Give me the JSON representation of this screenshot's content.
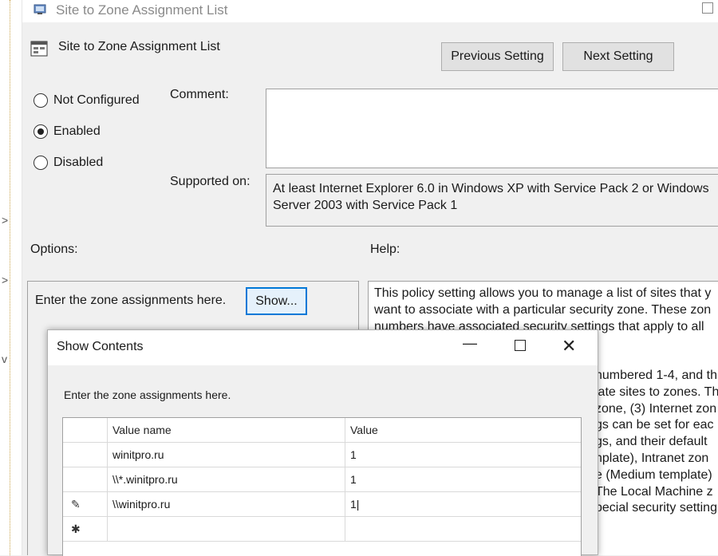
{
  "parent_tree": {
    "chevrons": [
      ">",
      ">",
      "v"
    ]
  },
  "window": {
    "title": "Site to Zone Assignment List"
  },
  "setting": {
    "name": "Site to Zone Assignment List",
    "previous_button": "Previous Setting",
    "next_button": "Next Setting"
  },
  "state": {
    "options": [
      {
        "label": "Not Configured",
        "selected": false
      },
      {
        "label": "Enabled",
        "selected": true
      },
      {
        "label": "Disabled",
        "selected": false
      }
    ]
  },
  "labels": {
    "comment": "Comment:",
    "supported_on": "Supported on:",
    "options": "Options:",
    "help": "Help:"
  },
  "supported_on_text": {
    "line1": "At least Internet Explorer 6.0 in Windows XP with Service Pack 2 or Windows",
    "line2": "Server 2003 with Service Pack 1"
  },
  "options_pane": {
    "prompt": "Enter the zone assignments here.",
    "show_button": "Show..."
  },
  "help_pane": {
    "line1": "This policy setting allows you to manage a list of sites that y",
    "line2": "want to associate with a particular security zone. These zon",
    "line3": "numbers have associated security settings that apply to all",
    "right_fragments": [
      "numbered 1-4, and th",
      "iate sites to zones. Th",
      "zone, (3) Internet zon",
      "gs can be set for eac",
      "gs, and their default",
      "nplate), Intranet zon",
      "e (Medium template)",
      "The Local Machine z",
      "pecial security setting"
    ]
  },
  "show_contents": {
    "title": "Show Contents",
    "prompt": "Enter the zone assignments here.",
    "columns": [
      "Value name",
      "Value"
    ],
    "rows": [
      {
        "marker": "",
        "name": "winitpro.ru",
        "value": "1"
      },
      {
        "marker": "",
        "name": "\\\\*.winitpro.ru",
        "value": "1"
      },
      {
        "marker": "✎",
        "name": "\\\\winitpro.ru",
        "value": "1|"
      },
      {
        "marker": "✱",
        "name": "",
        "value": ""
      }
    ]
  }
}
